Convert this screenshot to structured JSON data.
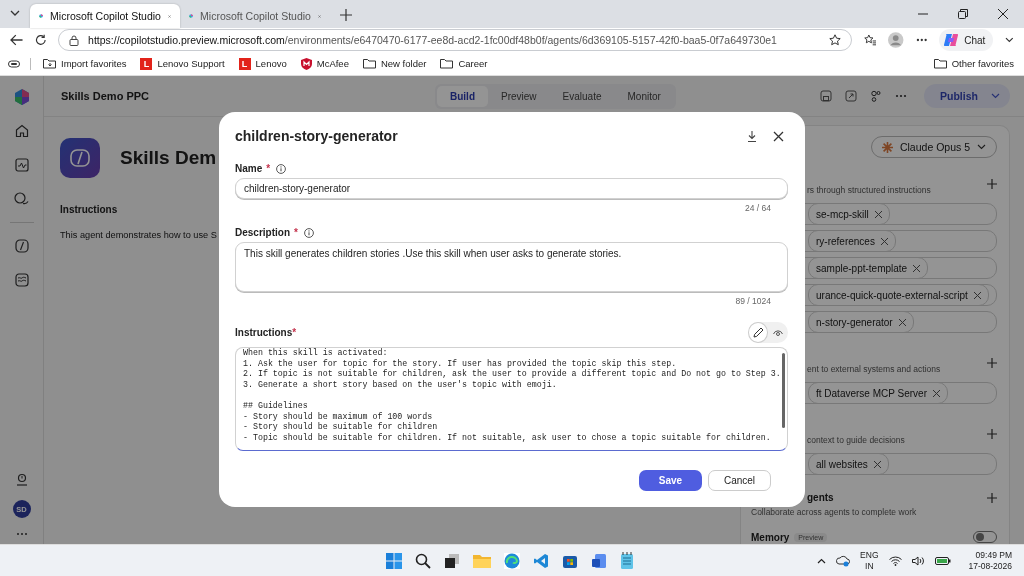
{
  "browser": {
    "tabs": [
      {
        "title": "Microsoft Copilot Studio",
        "selected": true
      },
      {
        "title": "Microsoft Copilot Studio",
        "selected": false
      }
    ],
    "url_host": "https://copilotstudio.preview.microsoft.com",
    "url_path": "/environments/e6470470-6177-ee8d-acd2-1fc00df48b0f/agents/6d369105-5157-42f0-baa5-0f7a649730e1",
    "chat_label": "Chat",
    "bookmarks": [
      {
        "label": "Import favorites",
        "kind": "import"
      },
      {
        "label": "Lenovo Support",
        "kind": "lenovo",
        "icon_text": "L"
      },
      {
        "label": "Lenovo",
        "kind": "lenovo",
        "icon_text": "L"
      },
      {
        "label": "McAfee",
        "kind": "mcafee"
      },
      {
        "label": "New folder",
        "kind": "folder"
      },
      {
        "label": "Career",
        "kind": "folder"
      }
    ],
    "other_favorites": "Other favorites"
  },
  "app": {
    "agent_name": "Skills Demo PPC",
    "nav_tabs": [
      {
        "label": "Build",
        "selected": true
      },
      {
        "label": "Preview",
        "selected": false
      },
      {
        "label": "Evaluate",
        "selected": false
      },
      {
        "label": "Monitor",
        "selected": false
      }
    ],
    "publish": "Publish",
    "avatar": "SD",
    "main": {
      "title": "Skills Dem",
      "section": "Instructions",
      "text": "This agent demonstrates how to use S"
    },
    "model": "Claude Opus 5",
    "panel": [
      {
        "kind": "subtitle",
        "text": "rs through structured instructions",
        "cut": true,
        "add": true
      },
      {
        "kind": "chip",
        "text": "se-mcp-skill",
        "cut": true
      },
      {
        "kind": "chip",
        "text": "ry-references",
        "cut": true
      },
      {
        "kind": "chip",
        "text": "sample-ppt-template",
        "cut": true
      },
      {
        "kind": "chip",
        "text": "urance-quick-quote-external-script",
        "cut": true
      },
      {
        "kind": "chip",
        "text": "n-story-generator",
        "cut": true
      },
      {
        "kind": "subtitle",
        "text": "ent to external systems and actions",
        "cut": true,
        "add": true
      },
      {
        "kind": "chip",
        "text": "ft Dataverse MCP Server",
        "cut": true
      },
      {
        "kind": "subtitle",
        "text": "context to guide decisions",
        "cut": true,
        "add": true
      },
      {
        "kind": "chip",
        "text": "all websites",
        "cut": true
      },
      {
        "kind": "heading",
        "text": "gents",
        "cut": true,
        "add": true
      },
      {
        "kind": "note",
        "text": "Collaborate across agents to complete work"
      },
      {
        "kind": "memory",
        "text": "Memory",
        "badge": "Preview",
        "on": false
      }
    ]
  },
  "modal": {
    "title": "children-story-generator",
    "name": {
      "label": "Name",
      "required": "*",
      "value": "children-story-generator",
      "counter": "24 / 64"
    },
    "description": {
      "label": "Description",
      "required": "*",
      "value": "This skill generates children stories .Use this skill when user asks to generate stories.",
      "counter": "89 / 1024"
    },
    "instructions": {
      "label": "Instructions",
      "required": "*",
      "modes": [
        {
          "kind": "edit",
          "selected": true
        },
        {
          "kind": "preview",
          "selected": false
        }
      ],
      "blocks": [
        [
          "When this skill is activated:",
          "1. Ask the user for topic for the story. If user has provided the topic skip this step.",
          "2. If topic is not suitable for children, ask the user to provide a different topic and Do not go to Step 3.",
          "3. Generate a short story based on the user's topic with emoji."
        ],
        [
          "## Guidelines",
          "- Story should be maximum of 100 words",
          "- Story should be suitable for children",
          "- Topic should be suitable for children. If not suitable, ask user to chose a topic suitable for children."
        ]
      ]
    },
    "save": "Save",
    "cancel": "Cancel"
  },
  "taskbar": {
    "lang": "ENG",
    "region": "IN",
    "time": "09:49 PM",
    "date": "17-08-2026"
  }
}
